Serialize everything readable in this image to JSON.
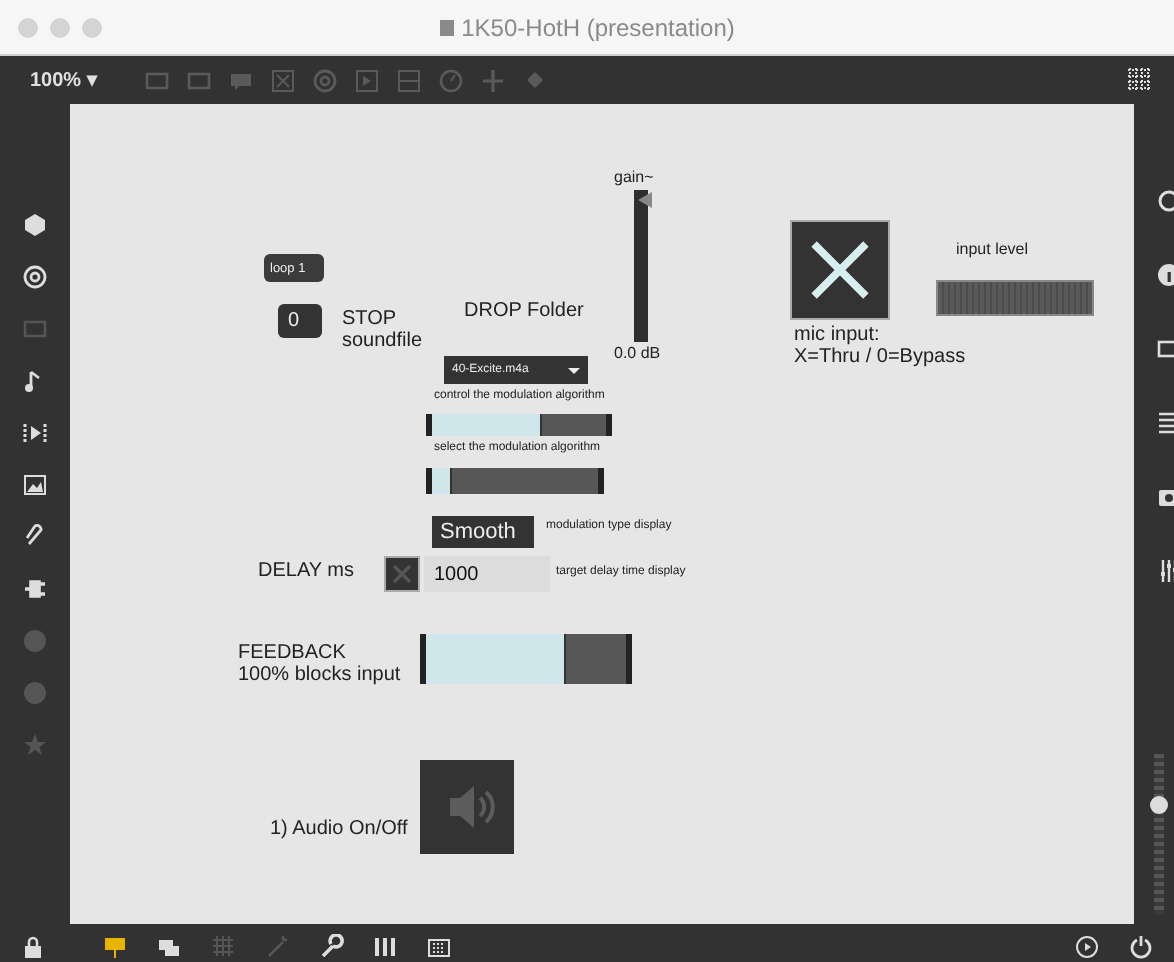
{
  "window": {
    "title": "1K50-HotH (presentation)"
  },
  "toolbar": {
    "zoom": "100% ▾"
  },
  "canvas": {
    "objects": [
      {
        "kind": "comment",
        "text": "gain~"
      },
      {
        "kind": "gain",
        "level": 0.93
      },
      {
        "kind": "comment",
        "text": "0.0 dB"
      },
      {
        "kind": "message",
        "text": "loop 1"
      },
      {
        "kind": "number",
        "text": "0"
      },
      {
        "kind": "comment",
        "text": "STOP soundfile"
      },
      {
        "kind": "comment",
        "text": "DROP Folder"
      },
      {
        "kind": "menu",
        "text": "40-Excite.m4a"
      },
      {
        "kind": "comment",
        "text": "control the modulation algorithm"
      },
      {
        "kind": "slider",
        "level": 0.63
      },
      {
        "kind": "comment",
        "text": "select the modulation algorithm"
      },
      {
        "kind": "slider",
        "level": 0.12
      },
      {
        "kind": "display",
        "text": "Smooth"
      },
      {
        "kind": "comment",
        "text": "modulation type display"
      },
      {
        "kind": "comment",
        "text": "DELAY ms"
      },
      {
        "kind": "toggle",
        "checked": false
      },
      {
        "kind": "number",
        "text": "1000"
      },
      {
        "kind": "comment",
        "text": "target delay time display"
      },
      {
        "kind": "comment",
        "text": "FEEDBACK 100% blocks input"
      },
      {
        "kind": "slider",
        "level": 0.7
      },
      {
        "kind": "ezdac",
        "on": false
      },
      {
        "kind": "comment",
        "text": "1) Audio On/Off"
      },
      {
        "kind": "toggle",
        "checked": true
      },
      {
        "kind": "comment",
        "text": "input level"
      },
      {
        "kind": "meter"
      },
      {
        "kind": "comment",
        "text": "mic input: X=Thru / 0=Bypass"
      }
    ]
  },
  "volume": {
    "level": 0.7
  }
}
